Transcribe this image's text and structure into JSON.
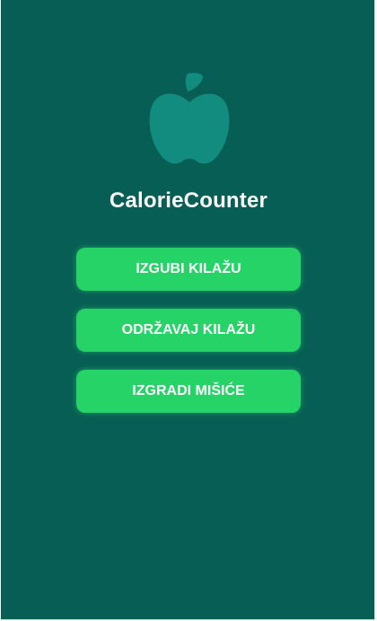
{
  "app": {
    "title": "CalorieCounter",
    "logo_icon": "apple-icon",
    "background_color": "#075e54",
    "accent_color": "#25d366",
    "logo_color": "#128c7e"
  },
  "goals": [
    {
      "label": "IZGUBI KILAŽU"
    },
    {
      "label": "ODRŽAVAJ KILAŽU"
    },
    {
      "label": "IZGRADI MIŠIĆE"
    }
  ]
}
